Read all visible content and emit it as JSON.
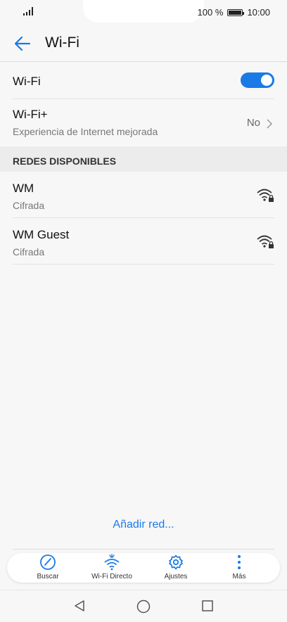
{
  "status_bar": {
    "battery_text": "100 %",
    "time": "10:00"
  },
  "app_bar": {
    "title": "Wi-Fi",
    "back_icon": "arrow-left-icon"
  },
  "wifi_toggle": {
    "label": "Wi-Fi",
    "state": "on"
  },
  "wifi_plus": {
    "title": "Wi-Fi+",
    "subtitle": "Experiencia de Internet mejorada",
    "value": "No"
  },
  "section": {
    "header": "REDES DISPONIBLES"
  },
  "networks": [
    {
      "name": "WM",
      "status": "Cifrada",
      "icon": "wifi-locked-icon"
    },
    {
      "name": "WM Guest",
      "status": "Cifrada",
      "icon": "wifi-locked-icon"
    }
  ],
  "add_network": {
    "label": "Añadir red..."
  },
  "bottom_bar": {
    "items": [
      {
        "label": "Buscar",
        "icon": "scan-icon"
      },
      {
        "label": "Wi-Fi Directo",
        "icon": "wifi-direct-icon"
      },
      {
        "label": "Ajustes",
        "icon": "gear-icon"
      },
      {
        "label": "Más",
        "icon": "more-vertical-icon"
      }
    ]
  },
  "colors": {
    "accent": "#1a7ae6",
    "background": "#f7f7f7",
    "section_bg": "#ececec"
  }
}
